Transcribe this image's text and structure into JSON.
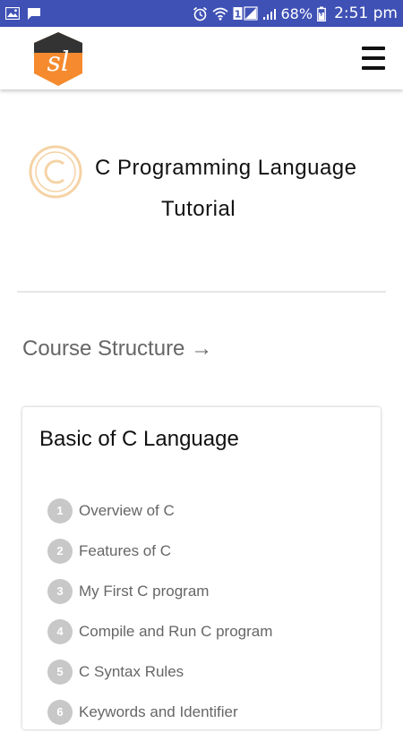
{
  "status_bar": {
    "battery_percent": "68%",
    "time": "2:51 pm",
    "sim_badge": "1",
    "icons": [
      "image-icon",
      "chat-icon",
      "alarm-icon",
      "wifi-icon",
      "sim-signal-icon",
      "signal-icon",
      "battery-icon"
    ],
    "color": "#3f51b5"
  },
  "header": {
    "logo_text": "sl",
    "logo_colors": {
      "top": "#333333",
      "bottom": "#f58a2e"
    },
    "menu_icon": "hamburger-menu-icon"
  },
  "hero": {
    "title_line1": "C Programming Language",
    "title_line2": "Tutorial",
    "icon": "copyright-c-icon",
    "icon_color": "#f5d3a6"
  },
  "course_structure": {
    "label": "Course Structure →"
  },
  "card": {
    "title": "Basic of C Language",
    "lessons": [
      {
        "number": "1",
        "label": "Overview of C"
      },
      {
        "number": "2",
        "label": "Features of C"
      },
      {
        "number": "3",
        "label": "My First C program"
      },
      {
        "number": "4",
        "label": "Compile and Run C program"
      },
      {
        "number": "5",
        "label": "C Syntax Rules"
      },
      {
        "number": "6",
        "label": "Keywords and Identifier"
      }
    ]
  }
}
